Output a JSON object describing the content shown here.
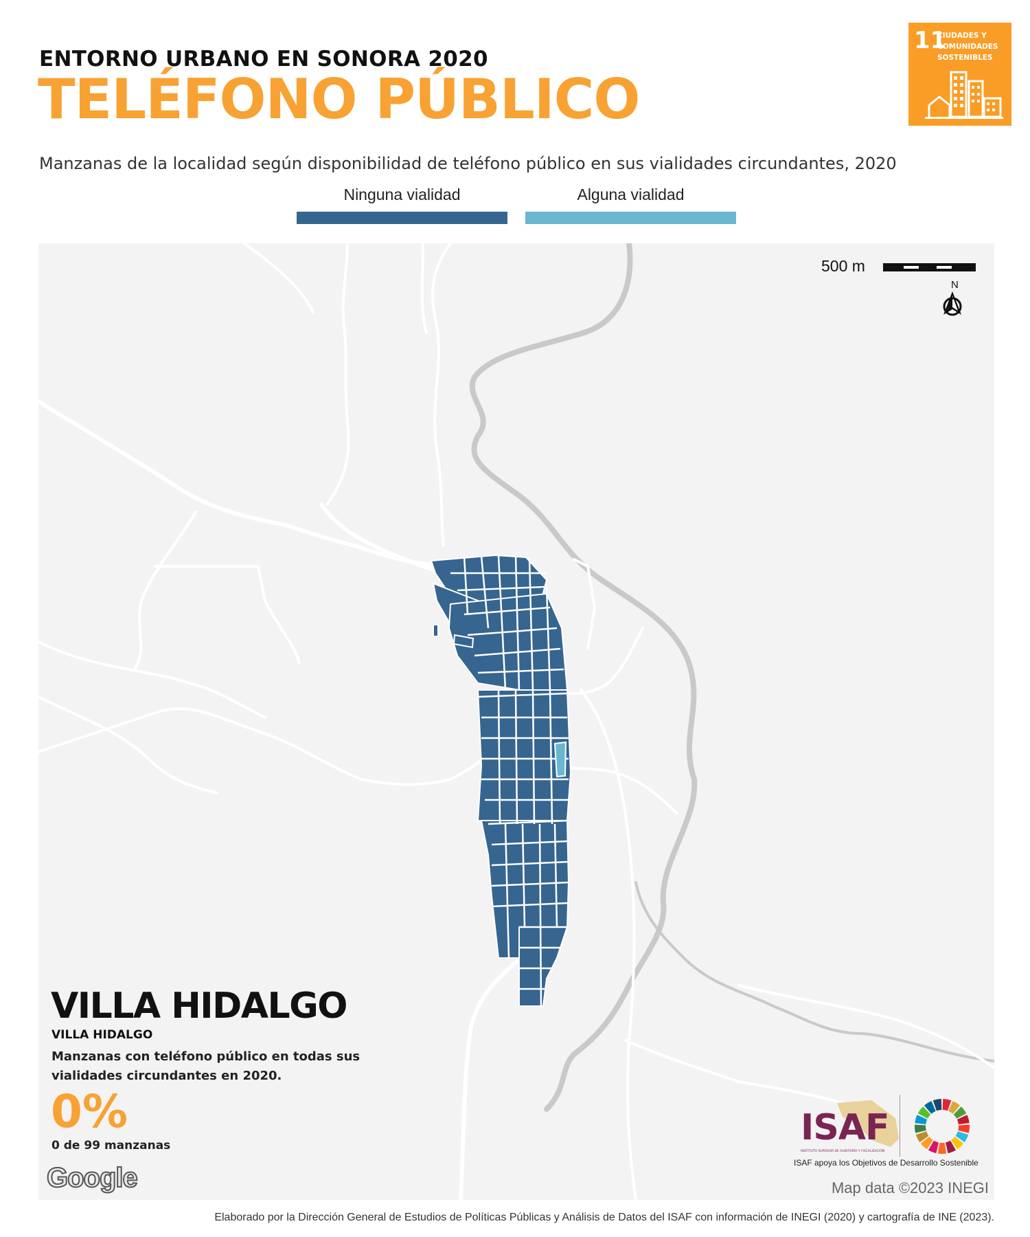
{
  "header": {
    "supertitle": "ENTORNO URBANO EN SONORA 2020",
    "title": "TELÉFONO PÚBLICO",
    "subtitle": "Manzanas de la localidad según disponibilidad de teléfono público en sus vialidades circundantes, 2020"
  },
  "legend": {
    "items": [
      {
        "label": "Ninguna vialidad",
        "color": "#36658f"
      },
      {
        "label": "Alguna vialidad",
        "color": "#6ab7d0"
      }
    ]
  },
  "sdg_badge": {
    "number": "11",
    "text_lines": [
      "CIUDADES Y",
      "COMUNIDADES",
      "SOSTENIBLES"
    ],
    "color": "#f99d26",
    "icon": "city-buildings-icon"
  },
  "map": {
    "scale_label": "500 m",
    "north_label": "N",
    "attribution": "Map data ©2023 INEGI",
    "google_logo": "Google",
    "background_color": "#f3f3f3",
    "road_color": "#ffffff",
    "river_color": "#c9c9c9"
  },
  "locality": {
    "name": "VILLA HIDALGO",
    "sub_name": "VILLA HIDALGO",
    "description": "Manzanas con teléfono público en todas sus vialidades circundantes en 2020.",
    "percentage": "0%",
    "count_text": "0 de 99 manzanas"
  },
  "logos": {
    "isaf": "ISAF",
    "isaf_fullname": "INSTITUTO SUPERIOR DE AUDITORÍA Y FISCALIZACIÓN",
    "caption": "ISAF apoya los Objetivos de Desarrollo Sostenible",
    "sdg_wheel_colors": [
      "#e5243b",
      "#dda63a",
      "#4c9f38",
      "#c5192d",
      "#ff3a21",
      "#26bde2",
      "#fcc30b",
      "#a21942",
      "#fd6925",
      "#dd1367",
      "#fd9d24",
      "#bf8b2e",
      "#3f7e44",
      "#0a97d9",
      "#56c02b",
      "#00689d",
      "#19486a"
    ]
  },
  "footer": {
    "text": "Elaborado por la Dirección General de Estudios de Políticas Públicas y Análisis de Datos del ISAF con información de INEGI (2020) y cartografía de INE (2023)."
  }
}
